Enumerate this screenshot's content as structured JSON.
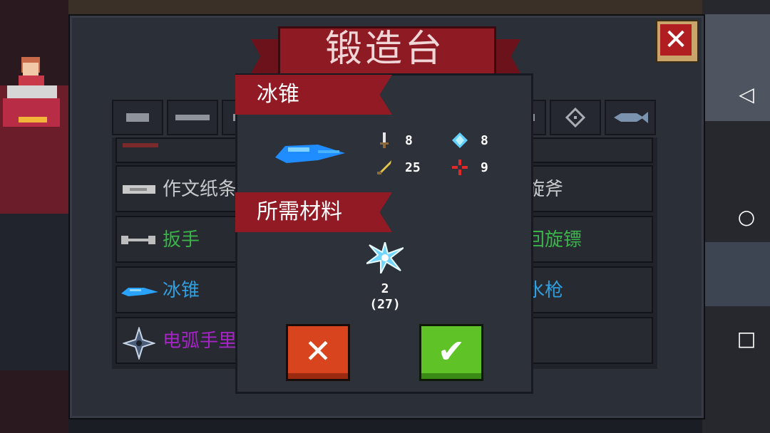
{
  "forge": {
    "title": "锻造台",
    "close_glyph": "✕"
  },
  "tabs": [
    {
      "name": "pistol-tab-icon"
    },
    {
      "name": "rifle-tab-icon"
    },
    {
      "name": "shotgun-tab-icon"
    },
    {
      "name": "launcher-tab-icon"
    },
    {
      "name": "target-tab-icon"
    },
    {
      "name": "fish-tab-icon"
    }
  ],
  "list": {
    "row0_left": "",
    "row0_right": "",
    "row1_left": "作文纸条",
    "row1_right": "旋斧",
    "row2_left": "扳手",
    "row2_right": "回旋镖",
    "row3_left": "冰锥",
    "row3_right": "水枪",
    "row4_left": "电弧手里",
    "colors": {
      "normal": "#c7c9cd",
      "green": "#3bb34a",
      "blue": "#2f9fe0",
      "purple": "#a624c6"
    }
  },
  "dialog": {
    "item_name": "冰锥",
    "stats": {
      "attack": "8",
      "energy": "8",
      "crit": "25",
      "accuracy": "9"
    },
    "materials_header": "所需材料",
    "material": {
      "icon": "ice-crystal-icon",
      "required": "2",
      "owned": "(27)"
    },
    "cancel_glyph": "✕",
    "confirm_glyph": "✔"
  },
  "nav": {
    "back": "◁",
    "home": "○",
    "recent": "□"
  }
}
